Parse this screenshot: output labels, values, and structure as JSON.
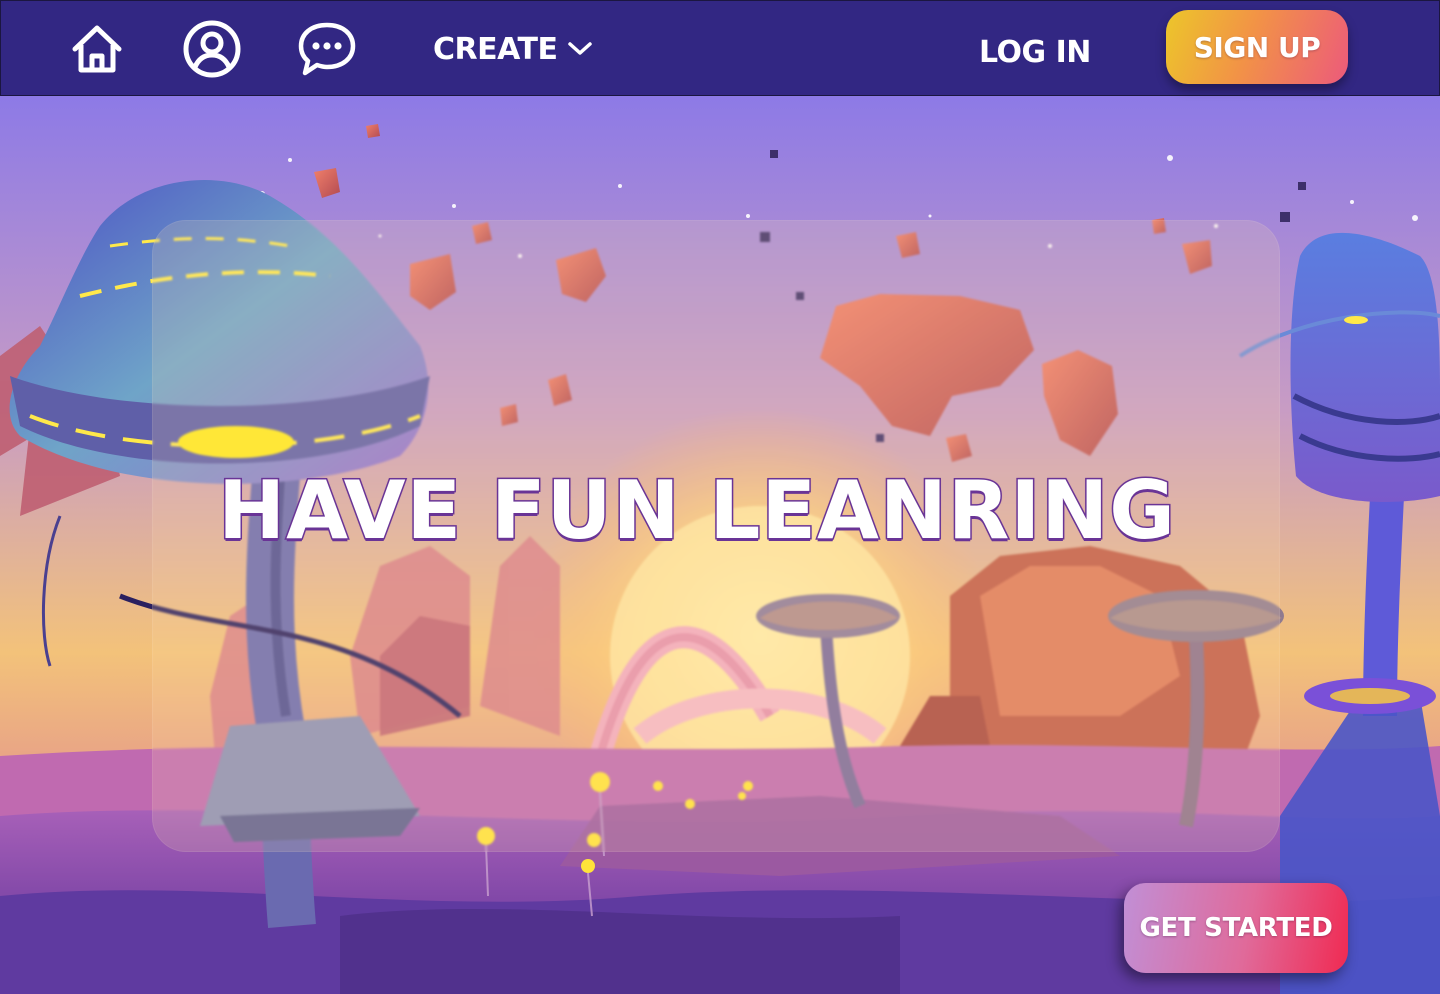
{
  "nav": {
    "icons": [
      "home-icon",
      "profile-icon",
      "chat-icon"
    ],
    "create_label": "CREATE",
    "login_label": "LOG IN",
    "signup_label": "SIGN UP"
  },
  "hero": {
    "title": "HAVE FUN LEANRING",
    "cta_label": "GET STARTED"
  },
  "colors": {
    "nav_bg": "#322783",
    "signup_gradient": [
      "#ecc62a",
      "#f29346",
      "#ec5a7b"
    ],
    "cta_gradient": [
      "#c18fd6",
      "#e06a9a",
      "#f02a52"
    ],
    "title_outline": "#6a3596"
  }
}
